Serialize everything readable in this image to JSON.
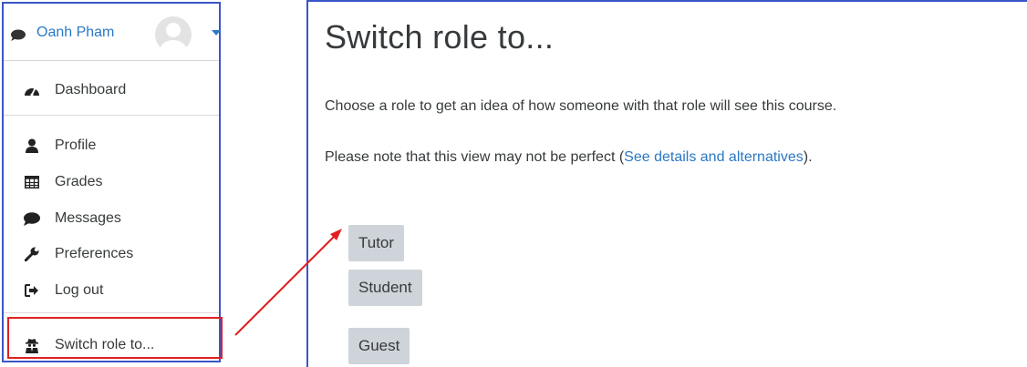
{
  "user_menu": {
    "user_name": "Oanh Pham",
    "items": [
      {
        "label": "Dashboard",
        "icon": "dashboard-icon"
      },
      {
        "label": "Profile",
        "icon": "user-icon"
      },
      {
        "label": "Grades",
        "icon": "table-icon"
      },
      {
        "label": "Messages",
        "icon": "comment-icon"
      },
      {
        "label": "Preferences",
        "icon": "wrench-icon"
      },
      {
        "label": "Log out",
        "icon": "sign-out-icon"
      },
      {
        "label": "Switch role to...",
        "icon": "user-secret-icon"
      }
    ]
  },
  "switch_role_page": {
    "title": "Switch role to...",
    "intro": "Choose a role to get an idea of how someone with that role will see this course.",
    "note_prefix": "Please note that this view may not be perfect (",
    "note_link": "See details and alternatives",
    "note_suffix": ").",
    "roles": [
      "Tutor",
      "Student",
      "Guest"
    ]
  },
  "colors": {
    "link": "#2b78c5",
    "panel_border": "#3a56c8",
    "highlight": "#e02020",
    "button_bg": "#ced4da"
  }
}
